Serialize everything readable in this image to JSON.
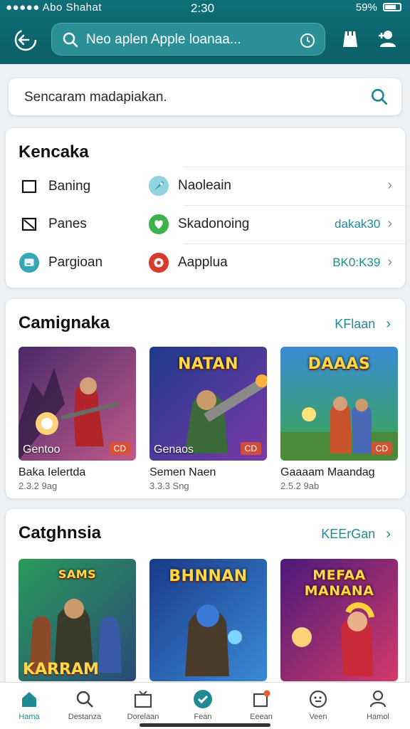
{
  "status_bar": {
    "left": "●●●●● Abo Shahat",
    "time": "2:30",
    "right": "59%"
  },
  "header": {
    "search_text": "Neo aplen Apple loanaa..."
  },
  "search2": {
    "placeholder": "Sencaram madapiakan."
  },
  "categories_card": {
    "title": "Kencaka",
    "left_items": [
      {
        "label": "Baning",
        "icon": "square-outline-icon"
      },
      {
        "label": "Panes",
        "icon": "square-cross-icon"
      },
      {
        "label": "Pargioan",
        "icon": "chat-bubble-icon"
      }
    ],
    "right_items": [
      {
        "label": "Naoleain",
        "value": "",
        "icon": "rocket-icon"
      },
      {
        "label": "Skadonoing",
        "value": "dakak30",
        "icon": "heart-icon"
      },
      {
        "label": "Aapplua",
        "value": "BK0:K39",
        "icon": "target-icon"
      }
    ]
  },
  "section1": {
    "title": "Camignaka",
    "link": "KFlaan",
    "games": [
      {
        "name": "Baka Ielertda",
        "meta": "2.3.2 9ag",
        "badge": "Gentoo",
        "tag": "CD",
        "art_title": ""
      },
      {
        "name": "Semen Naen",
        "meta": "3.3.3 Sng",
        "badge": "Genaos",
        "tag": "CD",
        "art_title": "NATAN"
      },
      {
        "name": "Gaaaam Maandag",
        "meta": "2.5.2 9ab",
        "badge": "",
        "tag": "CD",
        "art_title": "DAAAS"
      }
    ]
  },
  "section2": {
    "title": "Catghnsia",
    "link": "KEErGan",
    "games": [
      {
        "art_bottom": "KARRAM",
        "art_title": "SAMS"
      },
      {
        "art_title": "BHNNAN"
      },
      {
        "art_title": "MEFAA MANANA"
      }
    ]
  },
  "bottom_nav": [
    {
      "label": "Hama",
      "icon": "home-icon"
    },
    {
      "label": "Destanza",
      "icon": "search-icon"
    },
    {
      "label": "Dorelaan",
      "icon": "tv-icon"
    },
    {
      "label": "Fean",
      "icon": "check-circle-icon"
    },
    {
      "label": "Eeean",
      "icon": "puzzle-icon"
    },
    {
      "label": "Veen",
      "icon": "compass-icon"
    },
    {
      "label": "Hamol",
      "icon": "profile-icon"
    }
  ],
  "colors": {
    "header": "#0e6f78",
    "accent": "#1f8a93",
    "background": "#eef1f3"
  }
}
